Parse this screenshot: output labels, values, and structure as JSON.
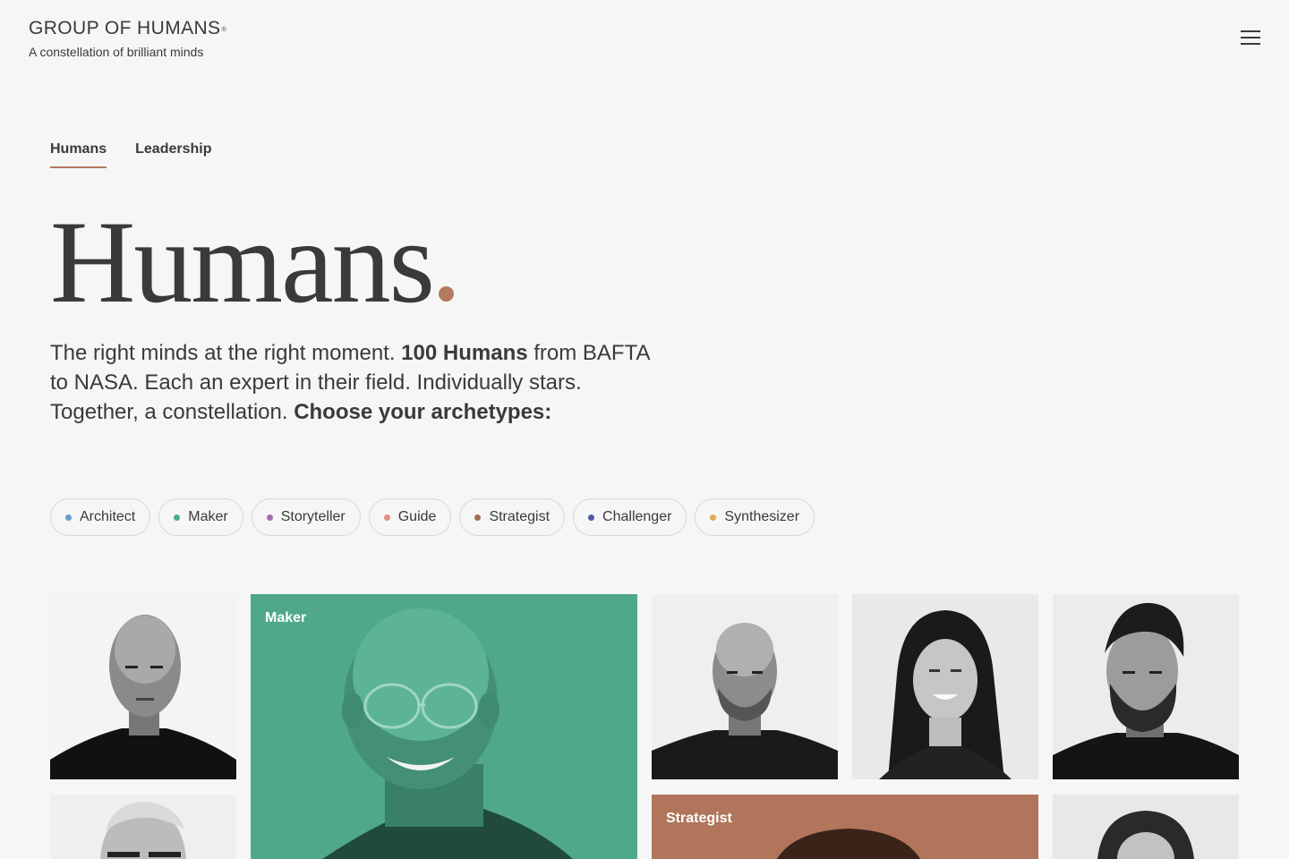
{
  "header": {
    "brand": "GROUP OF HUMANS",
    "brand_mark": "®",
    "tagline": "A constellation of brilliant minds",
    "menu_icon": "hamburger-menu-icon"
  },
  "tabs": [
    {
      "label": "Humans",
      "active": true
    },
    {
      "label": "Leadership",
      "active": false
    }
  ],
  "hero": {
    "title": "Humans",
    "accent_color": "#b37a5f",
    "intro_1": "The right minds at the right moment. ",
    "intro_bold_1": "100 Humans",
    "intro_2": " from BAFTA to NASA. Each an expert in their field. Individually stars. Together, a constellation. ",
    "intro_bold_2": "Choose your archetypes:"
  },
  "archetypes": [
    {
      "label": "Architect",
      "color": "#6a9bd1"
    },
    {
      "label": "Maker",
      "color": "#4caa8c"
    },
    {
      "label": "Storyteller",
      "color": "#a56fb0"
    },
    {
      "label": "Guide",
      "color": "#e08f7e"
    },
    {
      "label": "Strategist",
      "color": "#a46b4f"
    },
    {
      "label": "Challenger",
      "color": "#5058a6"
    },
    {
      "label": "Synthesizer",
      "color": "#e4aa4d"
    }
  ],
  "grid": {
    "featured_maker": {
      "label": "Maker",
      "color": "#4fa88c"
    },
    "featured_strategist": {
      "label": "Strategist",
      "color": "#b0755a"
    }
  }
}
